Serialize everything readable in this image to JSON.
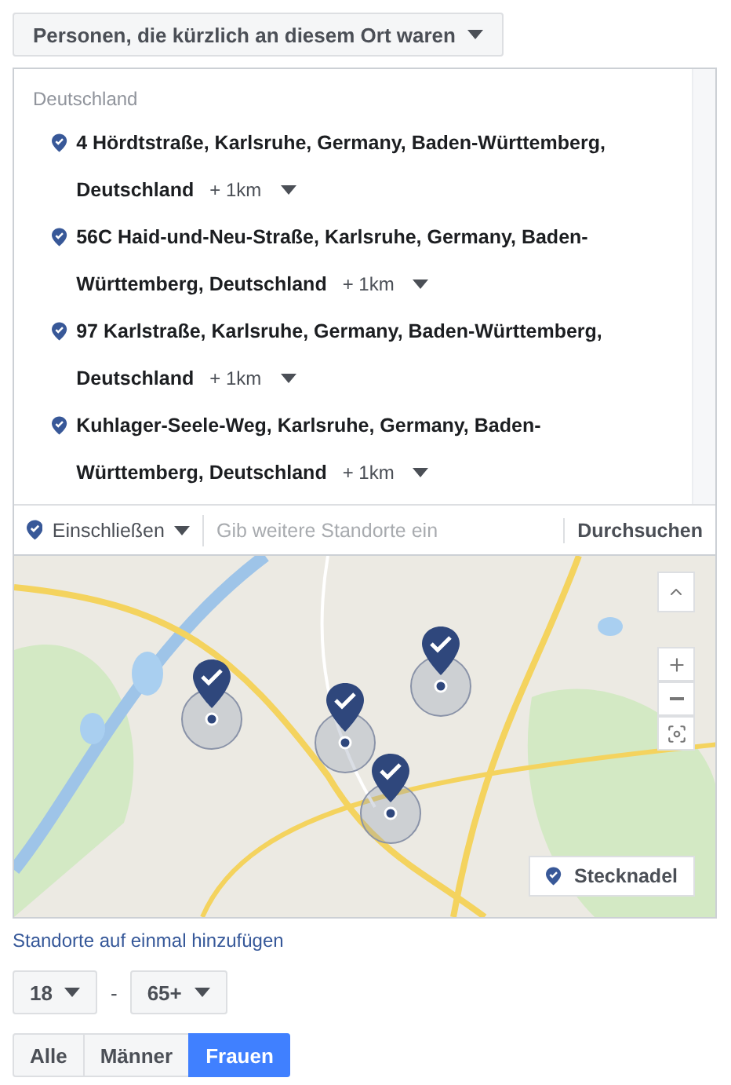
{
  "audience_dropdown": {
    "label": "Personen, die kürzlich an diesem Ort waren"
  },
  "country_heading": "Deutschland",
  "locations": [
    {
      "address_lines": [
        "4 Hördtstraße, Karlsruhe, Germany, Baden-Württemberg,",
        "Deutschland"
      ],
      "radius": "+ 1km"
    },
    {
      "address_lines": [
        "56C Haid-und-Neu-Straße, Karlsruhe, Germany, Baden-",
        "Württemberg, Deutschland"
      ],
      "radius": "+ 1km"
    },
    {
      "address_lines": [
        "97 Karlstraße, Karlsruhe, Germany, Baden-Württemberg,",
        "Deutschland"
      ],
      "radius": "+ 1km"
    },
    {
      "address_lines": [
        "Kuhlager-Seele-Weg, Karlsruhe, Germany, Baden-",
        "Württemberg, Deutschland"
      ],
      "radius": "+ 1km"
    }
  ],
  "search": {
    "mode": "Einschließen",
    "placeholder": "Gib weitere Standorte ein",
    "button": "Durchsuchen"
  },
  "map": {
    "kind": "picture",
    "pin_button": "Stecknadel"
  },
  "bulk_link": "Standorte auf einmal hinzufügen",
  "age": {
    "min": "18",
    "separator": "-",
    "max": "65+"
  },
  "gender": [
    {
      "label": "Alle",
      "selected": false
    },
    {
      "label": "Männer",
      "selected": false
    },
    {
      "label": "Frauen",
      "selected": true
    }
  ]
}
